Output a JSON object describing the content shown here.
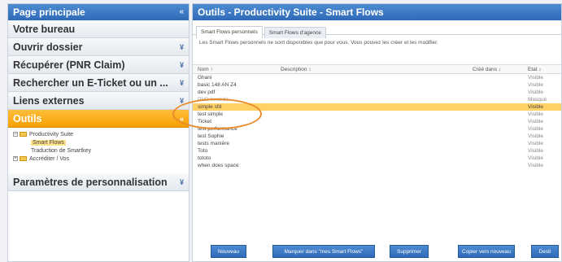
{
  "left": {
    "header": "Page principale",
    "collapse_glyph": "«",
    "nav": [
      {
        "label": "Votre bureau",
        "arrow": ""
      },
      {
        "label": "Ouvrir dossier",
        "arrow": "¥"
      },
      {
        "label": "Récupérer (PNR Claim)",
        "arrow": "¥"
      },
      {
        "label": "Rechercher un E-Ticket ou un ...",
        "arrow": "¥"
      },
      {
        "label": "Liens externes",
        "arrow": "¥"
      },
      {
        "label": "Outils",
        "arrow": "«"
      }
    ],
    "tree": [
      {
        "label": "Productivity Suite",
        "toggle": "–"
      },
      {
        "label": "Smart Flows"
      },
      {
        "label": "Traduction de Smartkey"
      },
      {
        "label": "Accréditer / Vos",
        "toggle": "+"
      }
    ],
    "settings": {
      "label": "Paramètres de personnalisation",
      "arrow": "¥"
    }
  },
  "right": {
    "header": "Outils - Productivity Suite - Smart Flows",
    "tabs": [
      "Smart Flows personnels",
      "Smart Flows d'agence"
    ],
    "info": "Les Smart Flows personnels ne sont disponibles que pour vous. Vous pouvez les créer et les modifier.",
    "columns": [
      "Nom ↑",
      "Description ↕",
      "Créé dans ↕",
      "Etat ↕"
    ],
    "rows": [
      {
        "name": "Ghani",
        "state": "Visible"
      },
      {
        "name": "basic 148 AN Z4",
        "state": "Visible"
      },
      {
        "name": "dev pdf",
        "state": "Visible"
      },
      {
        "name": "PNR Invalide",
        "state": "Masqué",
        "muted": true
      },
      {
        "name": "simple sfd",
        "state": "Visible",
        "selected": true
      },
      {
        "name": "test simple",
        "state": "Visible"
      },
      {
        "name": "Ticket",
        "state": "Visible"
      },
      {
        "name": "test performance",
        "state": "Visible"
      },
      {
        "name": "test Sophie",
        "state": "Visible"
      },
      {
        "name": "tests manière",
        "state": "Visible"
      },
      {
        "name": "Toto",
        "state": "Visible"
      },
      {
        "name": "tototo",
        "state": "Visible"
      },
      {
        "name": "when does space",
        "state": "Visible"
      }
    ],
    "buttons": {
      "new": "Nouveau",
      "mark": "Marquer dans \"mes Smart Flows\"",
      "delete": "Supprimer",
      "copy": "Copier vers nouveau",
      "last": "Desti"
    }
  },
  "colors": {
    "header_blue": "#3a78c5",
    "active_orange": "#f5a000",
    "selected_row": "#ffd166",
    "highlight_ring": "#e98a2a"
  }
}
